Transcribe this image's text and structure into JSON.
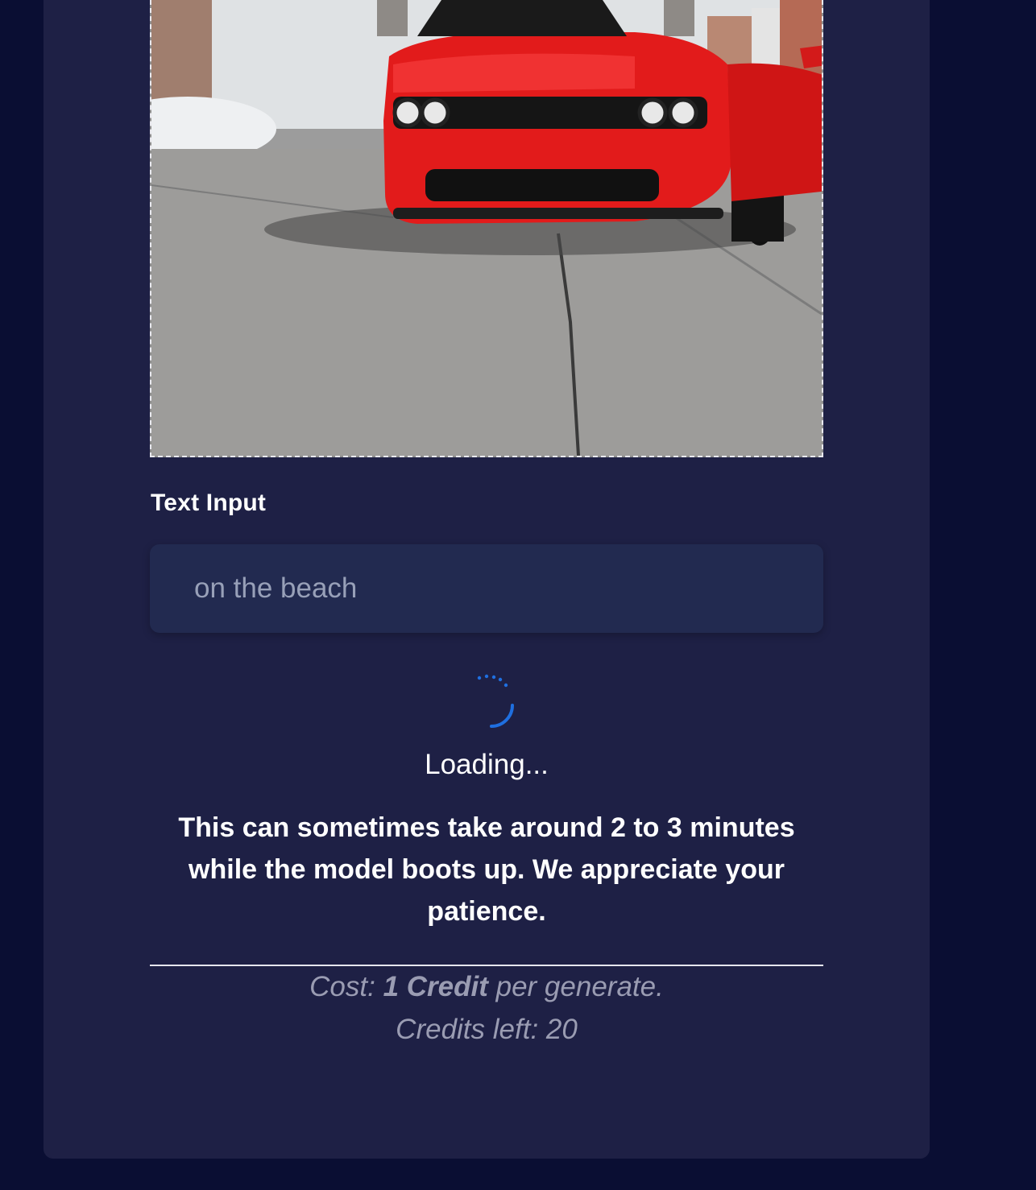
{
  "form": {
    "text_input_label": "Text Input",
    "text_input_value": "on the beach"
  },
  "status": {
    "loading_text": "Loading...",
    "wait_message": "This can sometimes take around 2 to 3 minutes while the model boots up. We appreciate your patience."
  },
  "pricing": {
    "cost_prefix": "Cost:",
    "cost_amount": "1 Credit",
    "cost_suffix": "per generate.",
    "credits_left": "Credits left: 20"
  },
  "colors": {
    "page_background": "#0a0e33",
    "card_background": "#1e2045",
    "input_background": "#222a50",
    "spinner_accent": "#1f6fe0"
  },
  "icons": {
    "spinner": "loading-spinner-icon"
  }
}
